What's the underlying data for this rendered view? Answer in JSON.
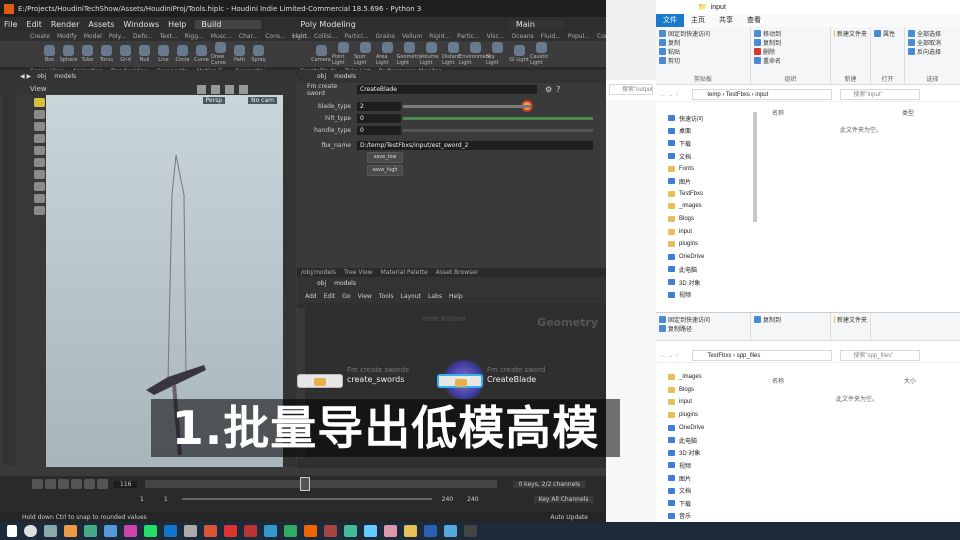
{
  "houdini": {
    "title": "E:/Projects/HoudiniTechShow/Assets/HoudiniProj/Tools.hiplc - Houdini Indie Limited-Commercial 18.5.696 - Python 3",
    "menu": [
      "File",
      "Edit",
      "Render",
      "Assets",
      "Windows",
      "Help"
    ],
    "desktop_build": "Build",
    "desktop_poly": "Poly Modeling",
    "desktop_main": "Main",
    "shelf_tabs_left": [
      "Create",
      "Modify",
      "Model",
      "Poly...",
      "Defo...",
      "Text...",
      "Rigg...",
      "Musc...",
      "Char...",
      "Cons...",
      "Hair..."
    ],
    "shelf_tabs_right": [
      "Light",
      "Collisi...",
      "Particl...",
      "Grains",
      "Vellum",
      "Rigid...",
      "Partic...",
      "Visc...",
      "Oceans",
      "Fluid...",
      "Popul...",
      "Conta...",
      "Pyro..."
    ],
    "shelf_tools_left": [
      "Box",
      "Sphere",
      "Tube",
      "Torus",
      "Grid",
      "Null",
      "Line",
      "Circle",
      "Curve",
      "Draw Curve",
      "Path",
      "Spray"
    ],
    "shelf_tools_right": [
      "Camera",
      "Point Light",
      "Spot Light",
      "Area Light",
      "Geometry Light",
      "Volume Light",
      "Distant Light",
      "Environment Light",
      "Sky Light",
      "GI Light",
      "Caustic Light"
    ],
    "left_pane_tabs": [
      "Scene View",
      "Animation",
      "Render View",
      "Composite",
      "Motion F...",
      "Geometry..."
    ],
    "right_pane_tabs": [
      "CreateBlade",
      "Take List",
      "Performance Monitor"
    ],
    "path_obj": "obj",
    "path_models": "models",
    "view_label": "View",
    "persp": "Persp",
    "no_cam": "No cam",
    "param_type": "Fm create sword",
    "param_name": "CreateBlade",
    "params": [
      {
        "label": "blade_type",
        "value": "2"
      },
      {
        "label": "hilt_type",
        "value": "0"
      },
      {
        "label": "handle_type",
        "value": "0"
      }
    ],
    "fbx_label": "fbx_name",
    "fbx_value": "D:/temp/TestFbxs/input/est_sword_2",
    "btn_save_low": "save_low",
    "btn_save_high": "save_high",
    "net_tabs": [
      "/obj/models",
      "Tree View",
      "Material Palette",
      "Asset Browser"
    ],
    "net_menu": [
      "Add",
      "Edit",
      "Go",
      "View",
      "Tools",
      "Layout",
      "Labs",
      "Help"
    ],
    "net_watermark_left": "Indie Edition",
    "net_watermark_right": "Geometry",
    "nodes": [
      {
        "type": "Fm create swords",
        "name": "create_swords"
      },
      {
        "type": "Fm create sword",
        "name": "CreateBlade"
      }
    ],
    "frame": "116",
    "frame_start": "1",
    "frame_start2": "1",
    "frame_end": "240",
    "frame_end2": "240",
    "keys_info": "0 keys, 2/2 channels",
    "key_all": "Key All Channels",
    "auto_update": "Auto Update",
    "status": "Hold down Ctrl to snap to rounded values"
  },
  "subtitle": "1.批量导出低模高模",
  "explorer_top": {
    "title": "input",
    "tabs": [
      "文件",
      "主页",
      "共享",
      "查看"
    ],
    "clipboard": [
      "固定到快速访问",
      "复制",
      "粘贴"
    ],
    "clip_items": [
      "剪切",
      "复制路径",
      "粘贴快捷方式"
    ],
    "organize": [
      "移动到",
      "复制到",
      "删除",
      "重命名"
    ],
    "new": [
      "新建文件夹",
      "新建"
    ],
    "open": [
      "属性",
      "打开"
    ],
    "select": [
      "全部选择",
      "全部取消",
      "反向选择"
    ],
    "groups": [
      "剪贴板",
      "组织",
      "新建",
      "打开",
      "选择"
    ],
    "address": [
      "temp",
      "TestFbxs",
      "input"
    ],
    "search": "搜索\"input\"",
    "nav": [
      "快速访问",
      "桌面",
      "下载",
      "文档",
      "Fonts",
      "图片",
      "TestFbxs",
      "_images",
      "Blogs",
      "input",
      "plugins",
      "OneDrive",
      "此电脑",
      "3D 对象",
      "视频"
    ],
    "col_name": "名称",
    "col_type": "类型",
    "empty": "此文件夹为空。"
  },
  "explorer_bottom": {
    "clipboard": [
      "固定到快速访问",
      "复制",
      "粘贴"
    ],
    "clip_items": [
      "剪切",
      "复制路径",
      "粘贴快捷方式"
    ],
    "organize": [
      "移动到",
      "复制到"
    ],
    "new": [
      "新建文件夹"
    ],
    "address": [
      "TestFbxs",
      "spp_files"
    ],
    "search": "搜索\"spp_files\"",
    "nav": [
      "_images",
      "Blogs",
      "input",
      "plugins",
      "OneDrive",
      "此电脑",
      "3D 对象",
      "视频",
      "图片",
      "文档",
      "下载",
      "音乐"
    ],
    "col_name": "名称",
    "col_size": "大小",
    "empty": "此文件夹为空。"
  },
  "output_search": "搜索\"output\"",
  "colors": {
    "houdini_bg": "#3a3a3a",
    "explorer_accent": "#1979ca",
    "taskbar": "#1c2a3a",
    "node_orange": "#e8b04a"
  }
}
